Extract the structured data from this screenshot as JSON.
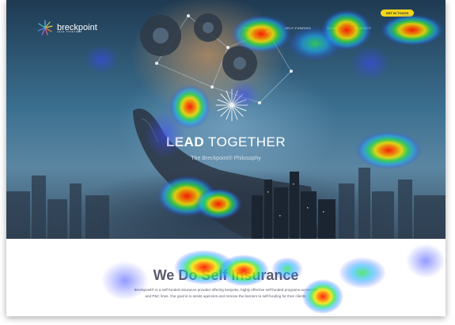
{
  "brand": {
    "name": "breckpoint",
    "tagline": "LEAD TOGETHER"
  },
  "nav": {
    "links": [
      "PHILOSOPHY",
      "SELF-FUNDING",
      "TEAM",
      "CONTACT"
    ],
    "cta_label": "GET IN TOUCH"
  },
  "hero": {
    "title_bold": "LEAD",
    "title_rest": " TOGETHER",
    "subtitle": "The Breckpoint® Philosophy"
  },
  "section": {
    "title": "We Do Self Insurance",
    "body": "Breckpoint® is a self-funded insurance provider offering bespoke, highly effective self-funded programs across EB and P&C lines. Our goal is to assist agencies and remove the barriers to self-funding for their clients."
  },
  "colors": {
    "cta": "#f4d619",
    "heading": "#5a5a6e",
    "hero_text": "#ffffff"
  },
  "heatmap_overlay": {
    "palette": [
      "blue",
      "cyan",
      "green",
      "yellow",
      "red"
    ],
    "hotspot_count": 11
  }
}
